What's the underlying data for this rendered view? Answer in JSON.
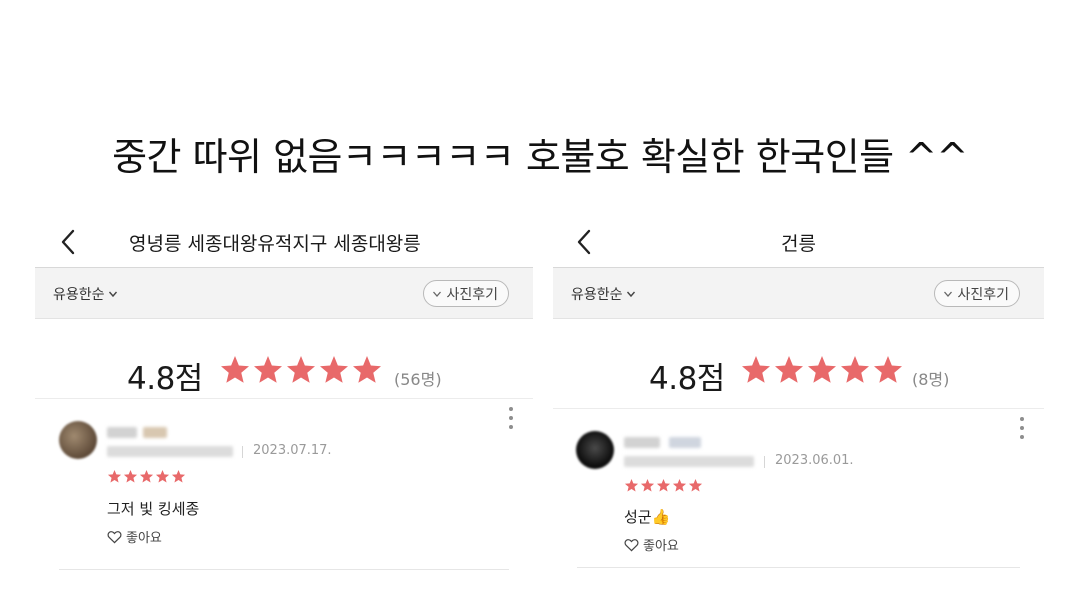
{
  "caption": "중간 따위 없음ㅋㅋㅋㅋㅋ 호불호 확실한 한국인들 ^^",
  "colors": {
    "star": "#e8696a",
    "filter_bg": "#f3f3f3"
  },
  "panels": [
    {
      "title": "영녕릉 세종대왕유적지구 세종대왕릉",
      "sort_label": "유용한순",
      "photo_filter_label": "사진후기",
      "score": "4.8점",
      "count": "(56명)",
      "review": {
        "date": "2023.07.17.",
        "rating": 5,
        "text": "그저 빛 킹세종",
        "like_label": "좋아요"
      }
    },
    {
      "title": "건릉",
      "sort_label": "유용한순",
      "photo_filter_label": "사진후기",
      "score": "4.8점",
      "count": "(8명)",
      "review": {
        "date": "2023.06.01.",
        "rating": 5,
        "text": "성군👍",
        "like_label": "좋아요"
      }
    }
  ]
}
